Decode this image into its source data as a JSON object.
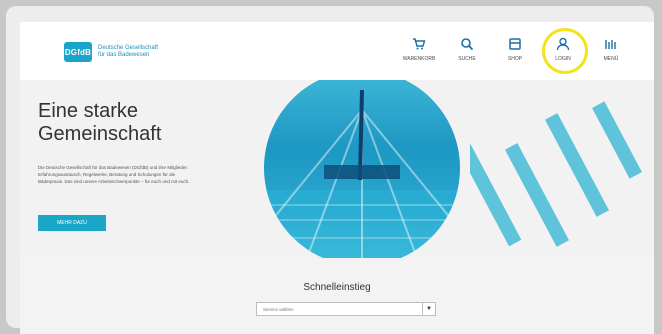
{
  "logo": {
    "mark": "DGfdB",
    "line1": "Deutsche Gesellschaft",
    "line2": "für das Badewesen"
  },
  "nav": [
    {
      "label": "WARENKORB",
      "icon": "cart-icon"
    },
    {
      "label": "SUCHE",
      "icon": "search-icon"
    },
    {
      "label": "SHOP",
      "icon": "shop-icon"
    },
    {
      "label": "LOGIN",
      "icon": "user-icon"
    },
    {
      "label": "MENÜ",
      "icon": "menu-icon"
    }
  ],
  "hero": {
    "title_line1": "Eine starke",
    "title_line2": "Gemeinschaft",
    "text": "Die Deutsche Gesellschaft für das Badewesen (DGfdB) und ihre Mitglieder: Erfahrungsaustausch, Regelwerke, Beratung und Schulungen für die Bäderpraxis. Das sind unsere Arbeitsschwerpunkte – für euch und mit euch.",
    "button": "MEHR DAZU"
  },
  "quick": {
    "title": "Schnelleinstieg",
    "select_value": "Service wählen"
  },
  "colors": {
    "accent": "#19a7c8",
    "highlight": "#f4e21f"
  }
}
